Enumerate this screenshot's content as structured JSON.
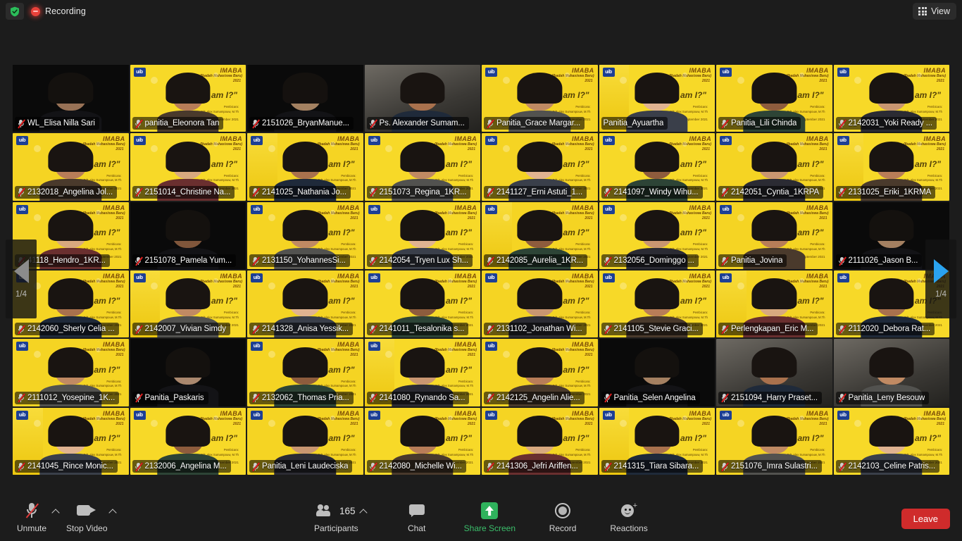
{
  "app": {
    "name": "Zoom Meeting",
    "background_color": "#1c1c1c"
  },
  "topbar": {
    "encryption_icon": "shield-check-icon",
    "recording_indicator_icon": "recording-dot-icon",
    "recording_label": "Recording",
    "view_icon": "grid-view-icon",
    "view_label": "View"
  },
  "gallery": {
    "columns": 8,
    "rows": 6,
    "active_speaker": "Panitia_Ayuartha",
    "active_border_color": "#f3c21b",
    "poster": {
      "org_badge": "uib",
      "brand": "IMABA",
      "subtitle": "(Ibadah Mahasiswa Baru)",
      "year": "2021",
      "headline": "\"Who am I?\"",
      "speaker_line1": "Pembicara:",
      "speaker_line2": "Pdt. Alex Sumampouw, M.Th",
      "date_line": "Sabtu, 18 September 2021"
    },
    "participants": [
      {
        "name": "WL_Elisa Nilla Sari",
        "muted": true,
        "video": "dark"
      },
      {
        "name": "panitia_Eleonora Tan",
        "muted": true,
        "video": "poster"
      },
      {
        "name": "2151026_BryanManue...",
        "muted": true,
        "video": "dark"
      },
      {
        "name": "Ps. Alexander Sumam...",
        "muted": true,
        "video": "room"
      },
      {
        "name": "Panitia_Grace Margar...",
        "muted": true,
        "video": "poster"
      },
      {
        "name": "Panitia_Ayuartha",
        "muted": false,
        "video": "poster"
      },
      {
        "name": "Panitia_Lili Chinda",
        "muted": true,
        "video": "poster"
      },
      {
        "name": "2142031_Yoki Ready ...",
        "muted": true,
        "video": "poster"
      },
      {
        "name": "2132018_Angelina Jol...",
        "muted": true,
        "video": "poster"
      },
      {
        "name": "2151014_Christine Na...",
        "muted": true,
        "video": "poster"
      },
      {
        "name": "2141025_Nathania Jo...",
        "muted": true,
        "video": "poster"
      },
      {
        "name": "2151073_Regina_1KR...",
        "muted": true,
        "video": "poster"
      },
      {
        "name": "2141127_Erni Astuti_1...",
        "muted": true,
        "video": "poster"
      },
      {
        "name": "2141097_Windy Wihu...",
        "muted": true,
        "video": "poster"
      },
      {
        "name": "2142051_Cyntia_1KRPA",
        "muted": true,
        "video": "poster"
      },
      {
        "name": "2131025_Eriki_1KRMA",
        "muted": true,
        "video": "poster"
      },
      {
        "name": "41118_Hendro_1KR...",
        "muted": true,
        "video": "poster"
      },
      {
        "name": "2151078_Pamela Yum...",
        "muted": true,
        "video": "dark"
      },
      {
        "name": "2131150_YohannesSi...",
        "muted": true,
        "video": "poster"
      },
      {
        "name": "2142054_Tryen Lux Sh...",
        "muted": true,
        "video": "poster"
      },
      {
        "name": "2142085_Aurelia_1KR...",
        "muted": true,
        "video": "poster"
      },
      {
        "name": "2132056_Dominggo ...",
        "muted": true,
        "video": "poster"
      },
      {
        "name": "Panitia_Jovina",
        "muted": true,
        "video": "poster"
      },
      {
        "name": "2111026_Jason B...",
        "muted": true,
        "video": "dark"
      },
      {
        "name": "2142060_Sherly Celia ...",
        "muted": true,
        "video": "poster"
      },
      {
        "name": "2142007_Vivian Simdy",
        "muted": true,
        "video": "poster"
      },
      {
        "name": "2141328_Anisa Yessik...",
        "muted": true,
        "video": "poster"
      },
      {
        "name": "2141011_Tesalonika s...",
        "muted": true,
        "video": "poster"
      },
      {
        "name": "2131102_Jonathan Wi...",
        "muted": true,
        "video": "poster"
      },
      {
        "name": "2141105_Stevie Graci...",
        "muted": true,
        "video": "poster"
      },
      {
        "name": "Perlengkapan_Eric M...",
        "muted": true,
        "video": "poster"
      },
      {
        "name": "2112020_Debora Rat...",
        "muted": true,
        "video": "poster"
      },
      {
        "name": "2111012_Yosepine_1K...",
        "muted": true,
        "video": "poster"
      },
      {
        "name": "Panitia_Paskaris",
        "muted": true,
        "video": "dark"
      },
      {
        "name": "2132062_Thomas Pria...",
        "muted": true,
        "video": "poster"
      },
      {
        "name": "2141080_Rynando Sa...",
        "muted": true,
        "video": "poster"
      },
      {
        "name": "2142125_Angelin Alie...",
        "muted": true,
        "video": "poster"
      },
      {
        "name": "Panitia_Selen Angelina",
        "muted": true,
        "video": "dark"
      },
      {
        "name": "2151094_Harry Praset...",
        "muted": true,
        "video": "room"
      },
      {
        "name": "Panitia_Leny Besouw",
        "muted": true,
        "video": "room"
      },
      {
        "name": "2141045_Rince Monic...",
        "muted": true,
        "video": "poster"
      },
      {
        "name": "2132006_Angelina M...",
        "muted": true,
        "video": "poster"
      },
      {
        "name": "Panitia_Leni Laudeciska",
        "muted": true,
        "video": "poster"
      },
      {
        "name": "2142080_Michelle Wi...",
        "muted": true,
        "video": "poster"
      },
      {
        "name": "2141306_Jefri Ariffen...",
        "muted": true,
        "video": "poster"
      },
      {
        "name": "2141315_Tiara Sibara...",
        "muted": true,
        "video": "poster"
      },
      {
        "name": "2151076_Imra Sulastri...",
        "muted": true,
        "video": "poster"
      },
      {
        "name": "2142103_Celine Patris...",
        "muted": true,
        "video": "poster"
      }
    ]
  },
  "pager": {
    "prev_icon": "chevron-left-icon",
    "next_icon": "chevron-right-icon",
    "page_left": "1/4",
    "page_right": "1/4",
    "prev_color": "#8b8b8b",
    "next_color": "#2aa3ef"
  },
  "toolbar": {
    "mute": {
      "icon": "microphone-muted-icon",
      "label": "Unmute",
      "caret": "chevron-up-icon"
    },
    "video": {
      "icon": "camera-icon",
      "label": "Stop Video",
      "caret": "chevron-up-icon"
    },
    "participants": {
      "icon": "people-icon",
      "label": "Participants",
      "count": "165",
      "caret": "chevron-up-icon"
    },
    "chat": {
      "icon": "chat-bubble-icon",
      "label": "Chat"
    },
    "share": {
      "icon": "share-screen-icon",
      "label": "Share Screen",
      "color": "#3bbf6b"
    },
    "record": {
      "icon": "record-circle-icon",
      "label": "Record"
    },
    "reactions": {
      "icon": "smiley-plus-icon",
      "label": "Reactions"
    },
    "leave": {
      "label": "Leave",
      "color": "#cf2b2b"
    }
  }
}
